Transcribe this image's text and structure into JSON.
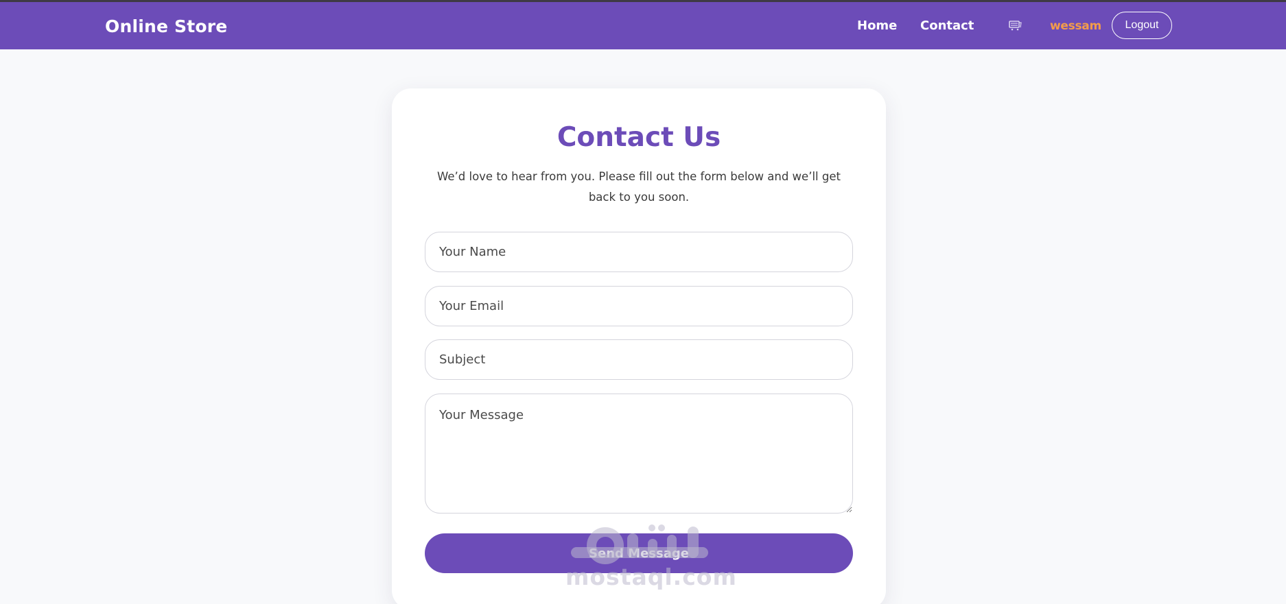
{
  "navbar": {
    "brand": "Online Store",
    "links": [
      {
        "label": "Home"
      },
      {
        "label": "Contact"
      }
    ],
    "cart_icon": "cart-icon",
    "username": "wessam",
    "logout_label": "Logout"
  },
  "contact": {
    "title": "Contact Us",
    "subtitle": "We’d love to hear from you. Please fill out the form below and we’ll get back to you soon.",
    "name_placeholder": "Your Name",
    "email_placeholder": "Your Email",
    "subject_placeholder": "Subject",
    "message_placeholder": "Your Message",
    "send_label": "Send Message"
  },
  "watermark": {
    "text": "mostaql.com"
  },
  "colors": {
    "primary": "#6c4cb8",
    "username": "#f39c4a",
    "page_bg": "#f8f9fb",
    "card_bg": "#ffffff"
  }
}
